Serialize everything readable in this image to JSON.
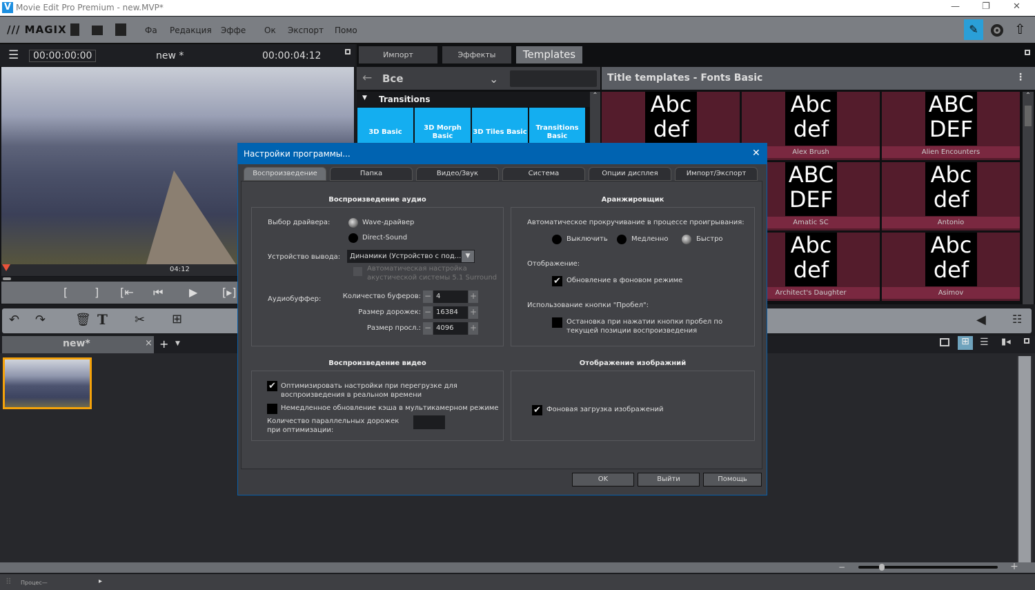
{
  "window": {
    "title": "Movie Edit Pro Premium - new.MVP*",
    "logo": "V",
    "minimize": "—",
    "restore": "❐",
    "close": "✕"
  },
  "menubar": {
    "brand": "MAGIX",
    "items": [
      "Фа",
      "Редакция",
      "Эффе",
      "Ок",
      "Экспорт",
      "Помо"
    ],
    "accent": "#2a9fd8"
  },
  "preview": {
    "timecode_current": "00:00:00:00",
    "project_name": "new *",
    "timecode_total": "00:00:04:12",
    "ruler_label": "04:12"
  },
  "right_panel": {
    "tabs": [
      "Импорт",
      "Эффекты",
      "Templates"
    ],
    "browser": {
      "category": "Все",
      "section": "Transitions",
      "tiles": [
        "3D Basic",
        "3D Morph Basic",
        "3D Tiles Basic",
        "Transitions Basic"
      ]
    },
    "templates": {
      "title": "Title templates - Fonts Basic",
      "fonts": [
        {
          "sample": "Abc def",
          "name": ""
        },
        {
          "sample": "Abc def",
          "name": "Alex Brush"
        },
        {
          "sample": "ABC DEF",
          "name": "Alien Encounters"
        },
        {
          "sample": "ABC DEF",
          "name": "Amatic SC"
        },
        {
          "sample": "Abc def",
          "name": "Antonio"
        },
        {
          "sample": "Abc def",
          "name": "Architect's Daughter"
        },
        {
          "sample": "Abc def",
          "name": "Asimov"
        }
      ]
    }
  },
  "timeline": {
    "doc_tab": "new*",
    "close": "×",
    "add": "+",
    "clip_selected_color": "#f5a20a"
  },
  "status": {
    "text": "Процес—"
  },
  "dialog": {
    "title": "Настройки программы...",
    "close": "✕",
    "tabs": [
      "Воспроизведение",
      "Папка",
      "Видео/Звук",
      "Система",
      "Опции дисплея",
      "Импорт/Экспорт"
    ],
    "active_tab": "Воспроизведение",
    "audio": {
      "heading": "Воспроизведение аудио",
      "driver_label": "Выбор драйвера:",
      "drivers": [
        "Wave-драйвер",
        "Direct-Sound"
      ],
      "driver_selected": "Wave-драйвер",
      "output_label": "Устройство вывода:",
      "output_value": "Динамики (Устройство с под...",
      "surround_label": "Автоматическая настройка акустической системы 5.1 Surround",
      "surround_checked": false,
      "buffer_label": "Аудиобуффер:",
      "buffers": [
        {
          "label": "Количество буферов:",
          "value": "4"
        },
        {
          "label": "Размер дорожек:",
          "value": "16384"
        },
        {
          "label": "Размер просл.:",
          "value": "4096"
        }
      ]
    },
    "arranger": {
      "heading": "Аранжировщик",
      "autoscroll_label": "Автоматическое прокручивание в процессе проигрывания:",
      "autoscroll_options": [
        "Выключить",
        "Медленно",
        "Быстро"
      ],
      "autoscroll_selected": "Быстро",
      "display_label": "Отображение:",
      "background_update": "Обновление в фоновом режиме",
      "background_update_checked": true,
      "space_label": "Использование кнопки \"Пробел\":",
      "space_stop": "Остановка при нажатии кнопки пробел по текущей позиции воспроизведения",
      "space_stop_checked": false
    },
    "video": {
      "heading": "Воспроизведение видео",
      "optimize": "Оптимизировать настройки при перегрузке для воспроизведения в реальном времени",
      "optimize_checked": true,
      "cache": "Немедленное обновление кэша в мультикамерном режиме",
      "cache_checked": false,
      "parallel_label": "Количество параллельных дорожек при оптимизации:",
      "parallel_value": ""
    },
    "images": {
      "heading": "Отображение изображний",
      "bg_load": "Фоновая загрузка изображений",
      "bg_load_checked": true
    },
    "buttons": {
      "ok": "OK",
      "exit": "Выйти",
      "help": "Помощь"
    }
  }
}
